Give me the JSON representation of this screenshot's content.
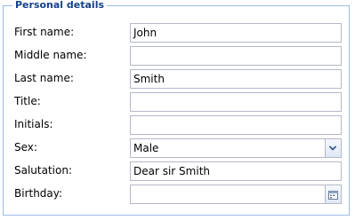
{
  "fieldset": {
    "title": "Personal details"
  },
  "fields": [
    {
      "label": "First name:",
      "value": "John",
      "type": "text"
    },
    {
      "label": "Middle name:",
      "value": "",
      "type": "text"
    },
    {
      "label": "Last name:",
      "value": "Smith",
      "type": "text"
    },
    {
      "label": "Title:",
      "value": "",
      "type": "text"
    },
    {
      "label": "Initials:",
      "value": "",
      "type": "text"
    },
    {
      "label": "Sex:",
      "value": "Male",
      "type": "combo",
      "icon": "chevron-down-icon"
    },
    {
      "label": "Salutation:",
      "value": "Dear sir Smith",
      "type": "text"
    },
    {
      "label": "Birthday:",
      "value": "",
      "type": "date",
      "icon": "calendar-icon"
    }
  ],
  "colors": {
    "border": "#99bbe8",
    "legend_text": "#15428b",
    "input_border": "#b5b8c8"
  }
}
